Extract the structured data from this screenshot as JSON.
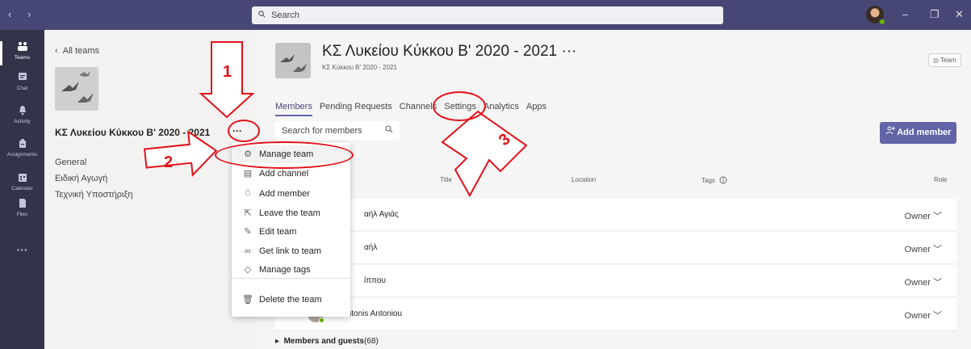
{
  "titlebar": {
    "nav_back": "‹",
    "nav_forward": "›",
    "search_placeholder": "Search",
    "minimize": "–",
    "maximize": "❐",
    "close": "✕"
  },
  "appbar": {
    "items": [
      {
        "label": "Teams",
        "icon": "teams-icon"
      },
      {
        "label": "Chat",
        "icon": "chat-icon"
      },
      {
        "label": "Activity",
        "icon": "bell-icon"
      },
      {
        "label": "Assignments",
        "icon": "assignments-icon"
      },
      {
        "label": "Calendar",
        "icon": "calendar-icon"
      },
      {
        "label": "Files",
        "icon": "files-icon"
      }
    ],
    "more": "···"
  },
  "leftpanel": {
    "back_label": "All teams",
    "team_name": "ΚΣ Λυκείου Κύκκου Β' 2020 - 2021",
    "more": "···",
    "channels": [
      "General",
      "Ειδική Αγωγή",
      "Τεχνική Υποστήριξη"
    ]
  },
  "main": {
    "team_title": "ΚΣ Λυκείου Κύκκου Β' 2020 - 2021 ···",
    "team_subtitle": "ΚΣ Κύκκου Β' 2020 - 2021",
    "team_badge": "◎ Team",
    "tabs": [
      "Members",
      "Pending Requests",
      "Channels",
      "Settings",
      "Analytics",
      "Apps"
    ],
    "search_placeholder": "Search for members",
    "add_member": "Add member",
    "columns": {
      "title": "Title",
      "location": "Location",
      "tags": "Tags",
      "role": "Role"
    },
    "rows": [
      {
        "name": "αήλ Αγιάς",
        "role": "Owner"
      },
      {
        "name": "αήλ",
        "role": "Owner"
      },
      {
        "name": "ίππου",
        "role": "Owner"
      },
      {
        "name": "Antonis Antoniou",
        "role": "Owner"
      }
    ],
    "guests_label": "Members and guests",
    "guests_count": "(68)"
  },
  "menu": {
    "items": [
      {
        "label": "Manage team",
        "icon": "gear-icon"
      },
      {
        "label": "Add channel",
        "icon": "add-channel-icon"
      },
      {
        "label": "Add member",
        "icon": "add-member-icon"
      },
      {
        "label": "Leave the team",
        "icon": "leave-icon"
      },
      {
        "label": "Edit team",
        "icon": "pencil-icon"
      },
      {
        "label": "Get link to team",
        "icon": "link-icon"
      },
      {
        "label": "Manage tags",
        "icon": "tag-icon"
      },
      {
        "label": "Delete the team",
        "icon": "trash-icon"
      }
    ]
  },
  "annotations": {
    "step1": "1",
    "step2": "2",
    "step3": "3",
    "color": "#e0121a"
  },
  "colors": {
    "titlebar": "#464775",
    "appbar": "#33344a",
    "accent": "#6264a7"
  }
}
